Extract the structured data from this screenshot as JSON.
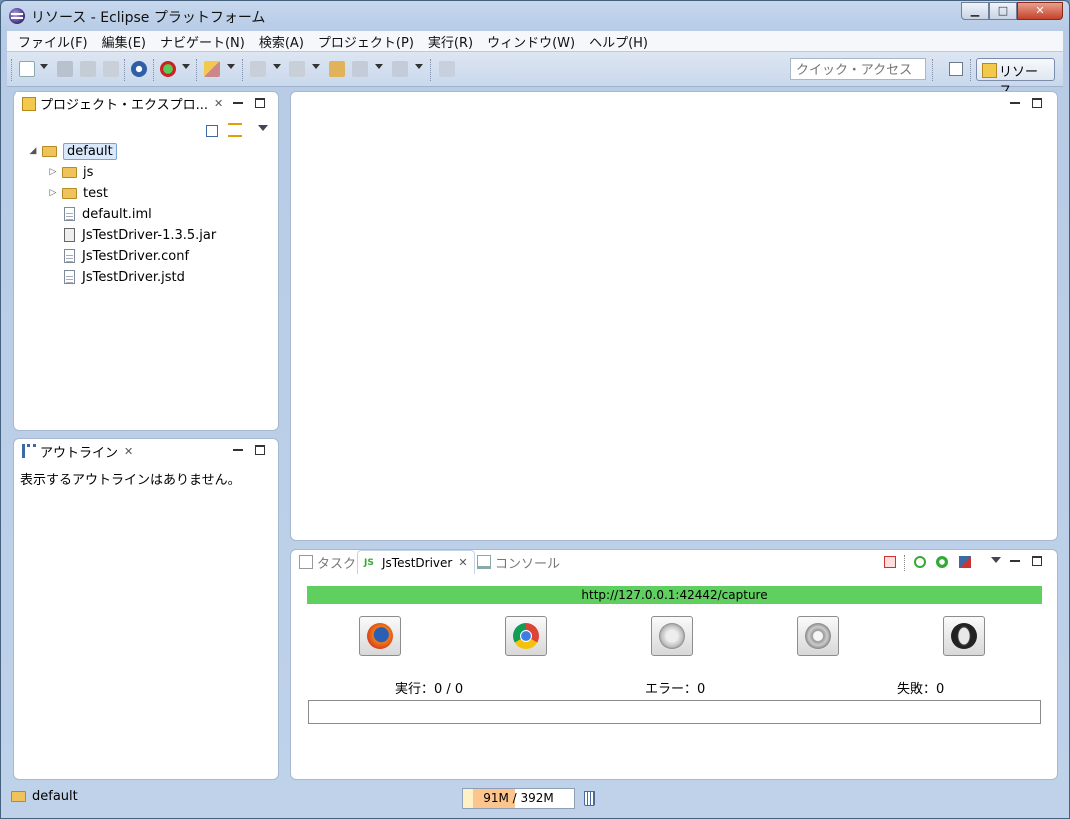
{
  "window": {
    "title": "リソース - Eclipse プラットフォーム",
    "buttons": {
      "minimize": "▁",
      "maximize": "□",
      "close": "✕"
    }
  },
  "menubar": {
    "items": [
      "ファイル(F)",
      "編集(E)",
      "ナビゲート(N)",
      "検索(A)",
      "プロジェクト(P)",
      "実行(R)",
      "ウィンドウ(W)",
      "ヘルプ(H)"
    ]
  },
  "toolbar": {
    "quick_access_placeholder": "クイック・アクセス",
    "perspective_label": "リソース"
  },
  "project_explorer": {
    "tab_label": "プロジェクト・エクスプロ...",
    "close_glyph": "✕",
    "tree": [
      {
        "label": "default",
        "type": "project",
        "expanded": true,
        "selected": true
      },
      {
        "label": "js",
        "type": "folder",
        "expanded": false
      },
      {
        "label": "test",
        "type": "folder",
        "expanded": false
      },
      {
        "label": "default.iml",
        "type": "file"
      },
      {
        "label": "JsTestDriver-1.3.5.jar",
        "type": "jar"
      },
      {
        "label": "JsTestDriver.conf",
        "type": "file"
      },
      {
        "label": "JsTestDriver.jstd",
        "type": "file"
      }
    ]
  },
  "outline": {
    "tab_label": "アウトライン",
    "close_glyph": "✕",
    "message": "表示するアウトラインはありません。"
  },
  "bottom_views": {
    "tabs": [
      {
        "label": "タスク",
        "active": false
      },
      {
        "label": "JsTestDriver",
        "active": true
      },
      {
        "label": "コンソール",
        "active": false
      }
    ],
    "close_glyph": "✕",
    "capture_url": "http://127.0.0.1:42442/capture",
    "browsers": [
      "firefox-icon",
      "chrome-icon",
      "safari-icon",
      "ie-icon",
      "opera-icon"
    ],
    "stats": {
      "run": "実行：0 / 0",
      "errors": "エラー：0",
      "failures": "失敗：0"
    },
    "accent_color": "#5fcf5f"
  },
  "statusbar": {
    "selection": "default",
    "heap": "91M / 392M",
    "heap_used_fraction": 0.23
  }
}
